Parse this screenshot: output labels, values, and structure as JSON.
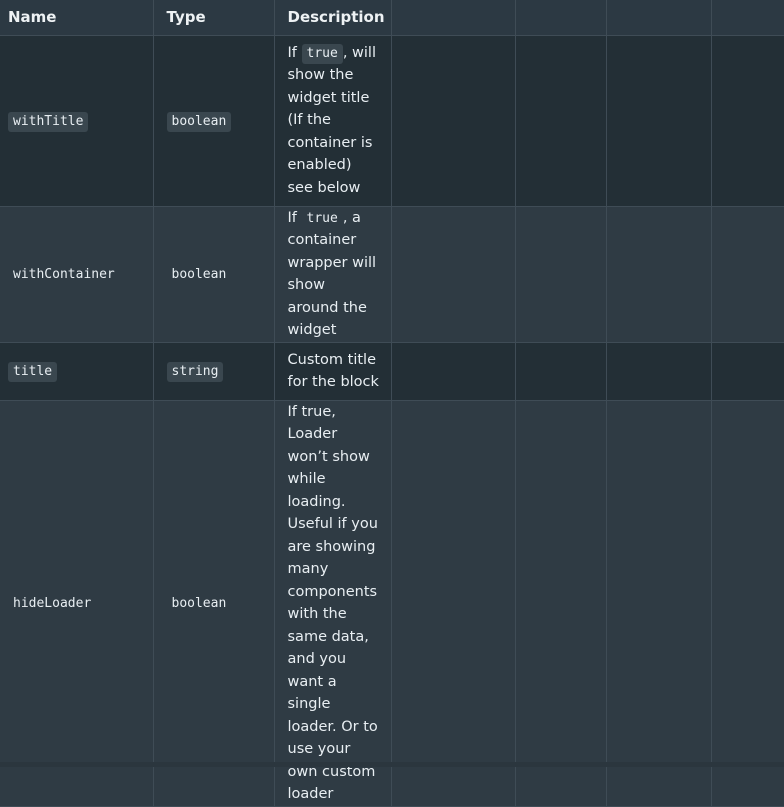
{
  "table": {
    "headers": {
      "name": "Name",
      "type": "Type",
      "description": "Description"
    },
    "rows": [
      {
        "name": "withTitle",
        "type": "boolean",
        "desc_before": "If ",
        "desc_code": "true",
        "desc_after": ", will show the widget title (If the container is enabled) see below"
      },
      {
        "name": "withContainer",
        "type": "boolean",
        "desc_before": "If ",
        "desc_code": "true",
        "desc_after": ", a container wrapper will show around the widget"
      },
      {
        "name": "title",
        "type": "string",
        "desc_text": "Custom title for the block"
      },
      {
        "name": "hideLoader",
        "type": "boolean",
        "desc_text": "If true, Loader won’t show while loading. Useful if you are showing many components with the same data, and you want a single loader. Or to use your own custom loader"
      }
    ]
  }
}
